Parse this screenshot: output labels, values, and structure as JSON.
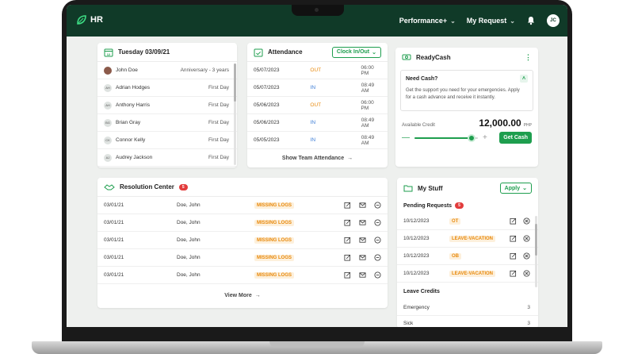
{
  "topbar": {
    "brand": "HR",
    "nav": [
      {
        "label": "Performance+"
      },
      {
        "label": "My Request"
      }
    ],
    "user_initials": "JC"
  },
  "anniversary_card": {
    "title": "Tuesday 03/09/21",
    "rows": [
      {
        "initials": "",
        "name": "John Doe",
        "event": "Anniversary - 3 years"
      },
      {
        "initials": "AH",
        "name": "Adrian Hodges",
        "event": "First Day"
      },
      {
        "initials": "AH",
        "name": "Anthony Harris",
        "event": "First Day"
      },
      {
        "initials": "BG",
        "name": "Brian Gray",
        "event": "First Day"
      },
      {
        "initials": "CK",
        "name": "Connor Kelly",
        "event": "First Day"
      },
      {
        "initials": "AJ",
        "name": "Audrey Jackson",
        "event": "First Day"
      }
    ]
  },
  "attendance_card": {
    "title": "Attendance",
    "clock_button": "Clock In/Out",
    "rows": [
      {
        "date": "05/07/2023",
        "type": "OUT",
        "time": "06:00 PM"
      },
      {
        "date": "05/07/2023",
        "type": "IN",
        "time": "08:49 AM"
      },
      {
        "date": "05/06/2023",
        "type": "OUT",
        "time": "06:00 PM"
      },
      {
        "date": "05/06/2023",
        "type": "IN",
        "time": "08:49 AM"
      },
      {
        "date": "05/05/2023",
        "type": "IN",
        "time": "08:49 AM"
      }
    ],
    "footer_link": "Show Team Attendance"
  },
  "readycash_card": {
    "title": "ReadyCash",
    "need_title": "Need Cash?",
    "need_text": "Get the support you need for your emergencies. Apply for a cash advance and receive it instantly.",
    "available_label": "Available Credit",
    "amount": "12,000.00",
    "currency": "PHP",
    "slider_level": 0.9,
    "get_cash_button": "Get Cash"
  },
  "resolution_card": {
    "title": "Resolution Center",
    "badge": "5",
    "rows": [
      {
        "date": "03/01/21",
        "name": "Doe, John",
        "status": "MISSING LOGS"
      },
      {
        "date": "03/01/21",
        "name": "Doe, John",
        "status": "MISSING LOGS"
      },
      {
        "date": "03/01/21",
        "name": "Doe, John",
        "status": "MISSING LOGS"
      },
      {
        "date": "03/01/21",
        "name": "Doe, John",
        "status": "MISSING LOGS"
      },
      {
        "date": "03/01/21",
        "name": "Doe, John",
        "status": "MISSING LOGS"
      }
    ],
    "footer_link": "View More"
  },
  "mystuff_card": {
    "title": "My Stuff",
    "apply_button": "Apply",
    "pending_label": "Pending Requests",
    "pending_badge": "5",
    "pending": [
      {
        "date": "10/12/2023",
        "type": "OT"
      },
      {
        "date": "10/12/2023",
        "type": "LEAVE-VACATION"
      },
      {
        "date": "10/12/2023",
        "type": "OB"
      },
      {
        "date": "10/12/2023",
        "type": "LEAVE-VACATION"
      }
    ],
    "credits_label": "Leave Credits",
    "credits": [
      {
        "name": "Emergency",
        "count": "3"
      },
      {
        "name": "Sick",
        "count": "3"
      }
    ]
  },
  "colors": {
    "brand_dark": "#103a28",
    "accent_green": "#1e9e4e",
    "warn_orange": "#e8890c",
    "in_blue": "#3a7bd5",
    "badge_red": "#e23c3c"
  }
}
